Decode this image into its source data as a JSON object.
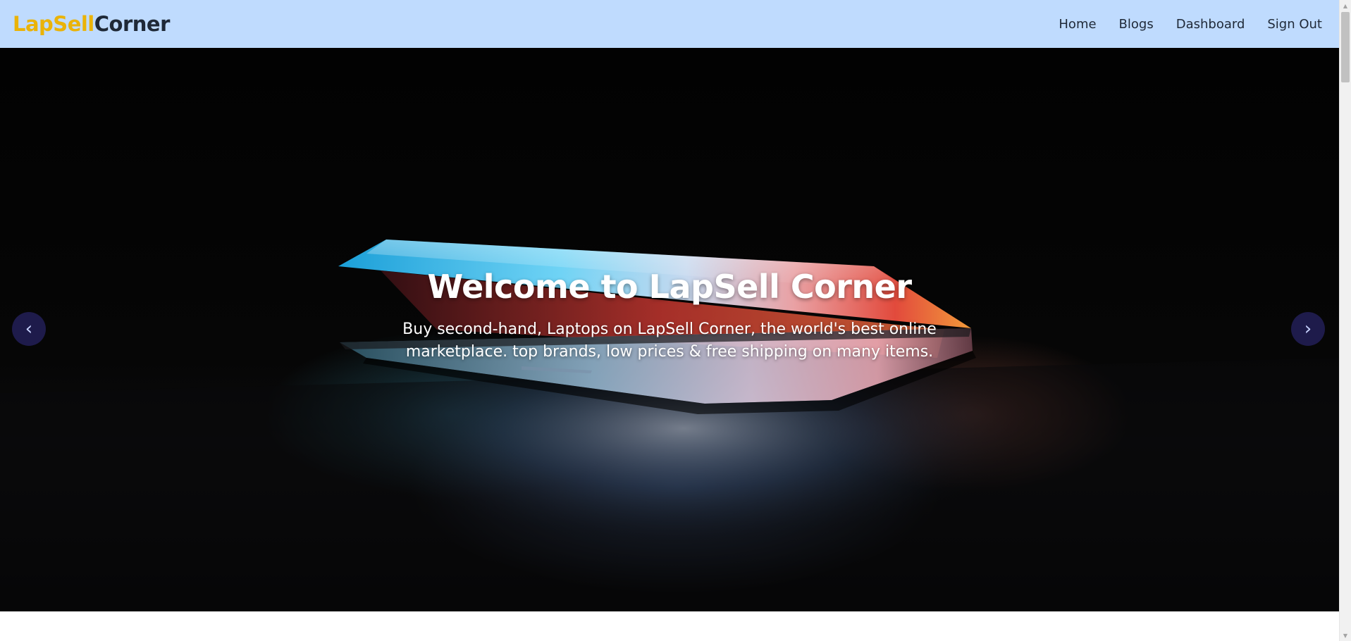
{
  "header": {
    "logo": {
      "part1": "LapSell",
      "part2": "Corner"
    },
    "nav": [
      {
        "label": "Home"
      },
      {
        "label": "Blogs"
      },
      {
        "label": "Dashboard"
      },
      {
        "label": "Sign Out"
      }
    ]
  },
  "hero": {
    "title": "Welcome to LapSell Corner",
    "subtitle": "Buy second-hand, Laptops on LapSell Corner, the world's best online marketplace. top brands, low prices & free shipping on many items.",
    "prev_icon": "‹",
    "next_icon": "›"
  },
  "colors": {
    "navbar_bg": "#bfdbfe",
    "logo_accent": "#eab308",
    "logo_dark": "#1f2937",
    "carousel_button": "#1e1b4b"
  }
}
